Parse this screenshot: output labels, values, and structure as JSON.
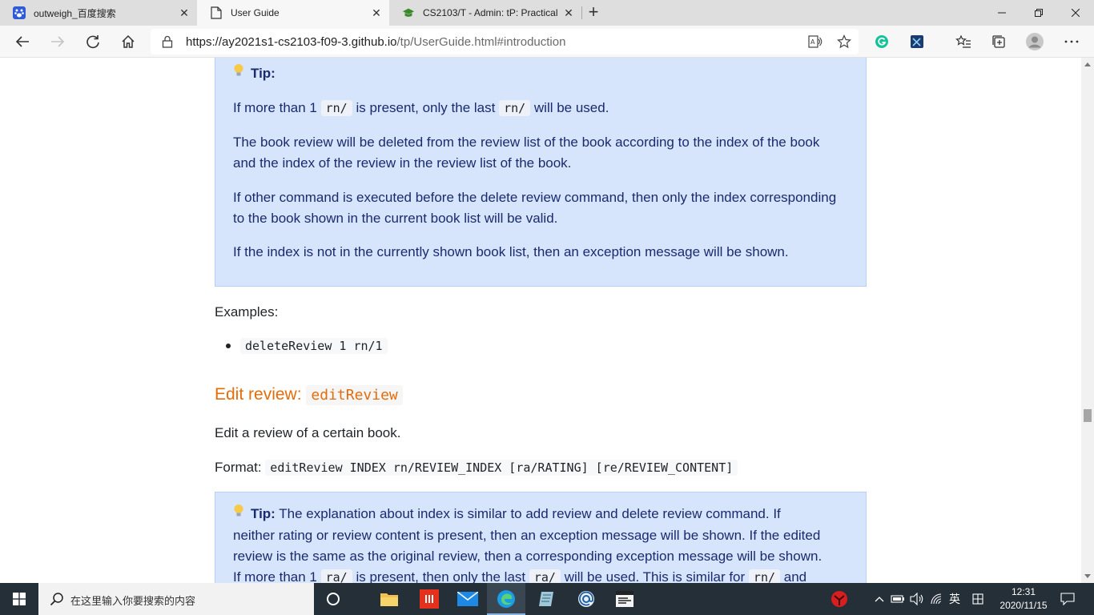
{
  "browser": {
    "tabs": [
      {
        "title": "outweigh_百度搜索",
        "icon": "baidu-paw-icon",
        "active": false
      },
      {
        "title": "User Guide",
        "icon": "page-icon",
        "active": true
      },
      {
        "title": "CS2103/T - Admin: tP: Practical E",
        "icon": "graduation-cap-icon",
        "active": false
      }
    ],
    "close_glyph": "✕",
    "new_tab_glyph": "+",
    "url_host": "https://ay2021s1-cs2103-f09-3.github.io",
    "url_path": "/tp/UserGuide.html#introduction"
  },
  "page": {
    "tip1": {
      "label": "Tip:",
      "line1_pre": "If more than 1",
      "code": "rn/",
      "line1_mid": "is present, only the last",
      "line1_post": "will be used.",
      "p2": "The book review will be deleted from the review list of the book according to the index of the book and the index of the review in the review list of the book.",
      "p3": "If other command is executed before the delete review command, then only the index corresponding to the book shown in the current book list will be valid.",
      "p4": "If the index is not in the currently shown book list, then an exception message will be shown."
    },
    "examples_label": "Examples:",
    "example_code": "deleteReview 1 rn/1",
    "section_title": "Edit review:",
    "section_code": "editReview",
    "description": "Edit a review of a certain book.",
    "format_label": "Format:",
    "format_code": "editReview INDEX rn/REVIEW_INDEX [ra/RATING] [re/REVIEW_CONTENT]",
    "tip2": {
      "label": "Tip:",
      "text_a": "The explanation about index is similar to add review and delete review command. If",
      "text_b": "neither rating or review content is present, then an exception message will be shown. If the edited",
      "text_c": "review is the same as the original review, then a corresponding exception message will be shown.",
      "line4_pre": "If more than 1",
      "code_ra": "ra/",
      "line4_mid": "is present, then only the last",
      "line4_mid2": "will be used. This is similar for",
      "code_rn": "rn/",
      "line4_post": "and"
    }
  },
  "taskbar": {
    "search_placeholder": "在这里输入你要搜索的内容",
    "ime_lang": "英",
    "time": "12:31",
    "date": "2020/11/15"
  }
}
